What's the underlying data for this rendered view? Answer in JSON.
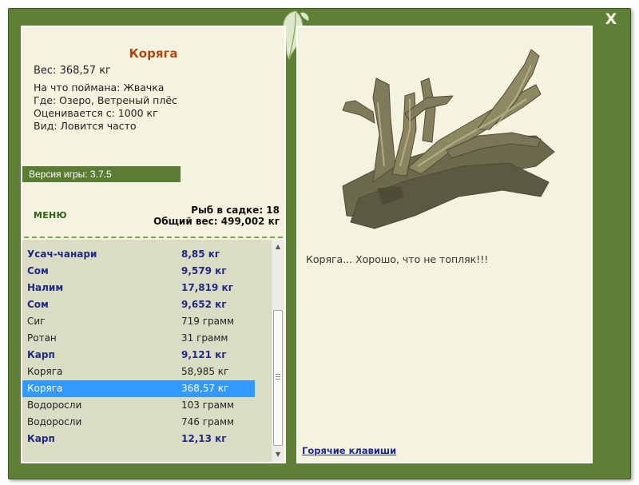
{
  "window": {
    "close_label": "X"
  },
  "item": {
    "name": "Коряга",
    "weight": "Вес: 368,57 кг",
    "bait": "На что поймана: Жвачка",
    "location": "Где: Озеро, Ветреный плёс",
    "value": "Оценивается с: 1000 кг",
    "kind": "Вид: Ловится часто"
  },
  "version": "Версия игры: 3.7.5",
  "menu_label": "МЕНЮ",
  "stats": {
    "fish_count": "Рыб в садке: 18",
    "total_weight": "Общий вес: 499,002 кг"
  },
  "fish_list": [
    {
      "name": "Усач-чанари",
      "weight": "8,85 кг"
    },
    {
      "name": "Сом",
      "weight": "9,579 кг"
    },
    {
      "name": "Налим",
      "weight": "17,819 кг"
    },
    {
      "name": "Сом",
      "weight": "9,652 кг"
    },
    {
      "name": "Сиг",
      "weight": "719 грамм"
    },
    {
      "name": "Ротан",
      "weight": "31 грамм"
    },
    {
      "name": "Карп",
      "weight": "9,121 кг"
    },
    {
      "name": "Коряга",
      "weight": "58,985 кг"
    },
    {
      "name": "Коряга",
      "weight": "368,57 кг"
    },
    {
      "name": "Водоросли",
      "weight": "103 грамм"
    },
    {
      "name": "Водоросли",
      "weight": "746 грамм"
    },
    {
      "name": "Карп",
      "weight": "12,13 кг"
    }
  ],
  "caption": "Коряга... Хорошо, что не топляк!!!",
  "hotkeys_label": "Горячие клавиши",
  "colors": {
    "frame": "#5f7f36",
    "panel": "#f3f3df",
    "title": "#b1470f",
    "trophy_text": "#1e2a86",
    "selection": "#3399ff"
  },
  "icons": [
    "close-icon",
    "leaf-icon",
    "scroll-up-arrow-icon",
    "scroll-down-arrow-icon",
    "driftwood-image"
  ]
}
